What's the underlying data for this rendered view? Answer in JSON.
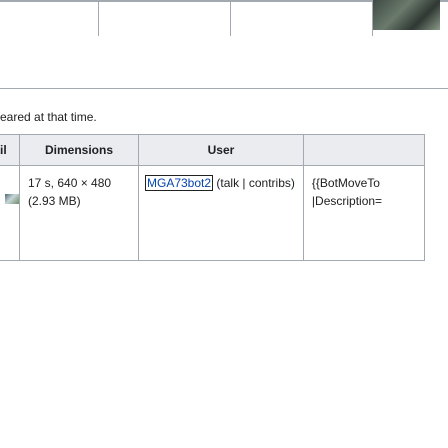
{
  "note": {
    "text": "eared at that time."
  },
  "table": {
    "headers": {
      "thumbnail": "ail",
      "dimensions": "Dimensions",
      "user": "User",
      "comment": ""
    },
    "row": {
      "dimensions_line1": "17 s, 640 × 480",
      "dimensions_line2": "(2.93 MB)",
      "user_name": "MGA73bot2",
      "user_links_open": " (",
      "user_talk": "talk",
      "user_sep": " | ",
      "user_contribs": "contribs",
      "user_links_close": ")",
      "comment_line1": "{{BotMoveTo",
      "comment_line2": "|Description="
    }
  }
}
